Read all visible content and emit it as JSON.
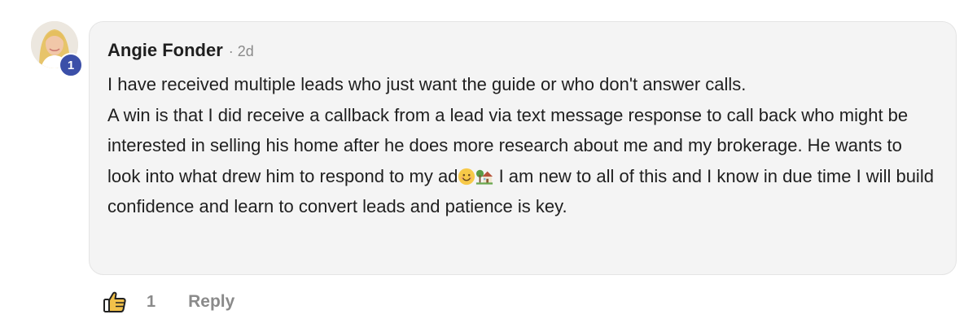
{
  "comment": {
    "author": "Angie Fonder",
    "separator": "·",
    "time": "2d",
    "level_badge": "1",
    "line1": "I have received multiple leads who just want the guide or who don't answer calls.",
    "line2_before_emoji": "A win is that I did receive a callback from a lead via text message response to call back who might be interested in selling his home after he does more research about me and my brokerage. He wants to look into what drew him to respond to my ad",
    "emojis": [
      "smiling-face-icon",
      "house-with-garden-icon"
    ],
    "line2_after_emoji": " I am new to all of this and I know in due time I will build confidence and learn to convert leads and patience is key."
  },
  "actions": {
    "like_icon": "thumbs-up-icon",
    "like_count": "1",
    "reply_label": "Reply"
  },
  "colors": {
    "bubble_background": "#f4f4f4",
    "badge": "#3b4fa8",
    "muted_text": "#8a8a8a"
  }
}
